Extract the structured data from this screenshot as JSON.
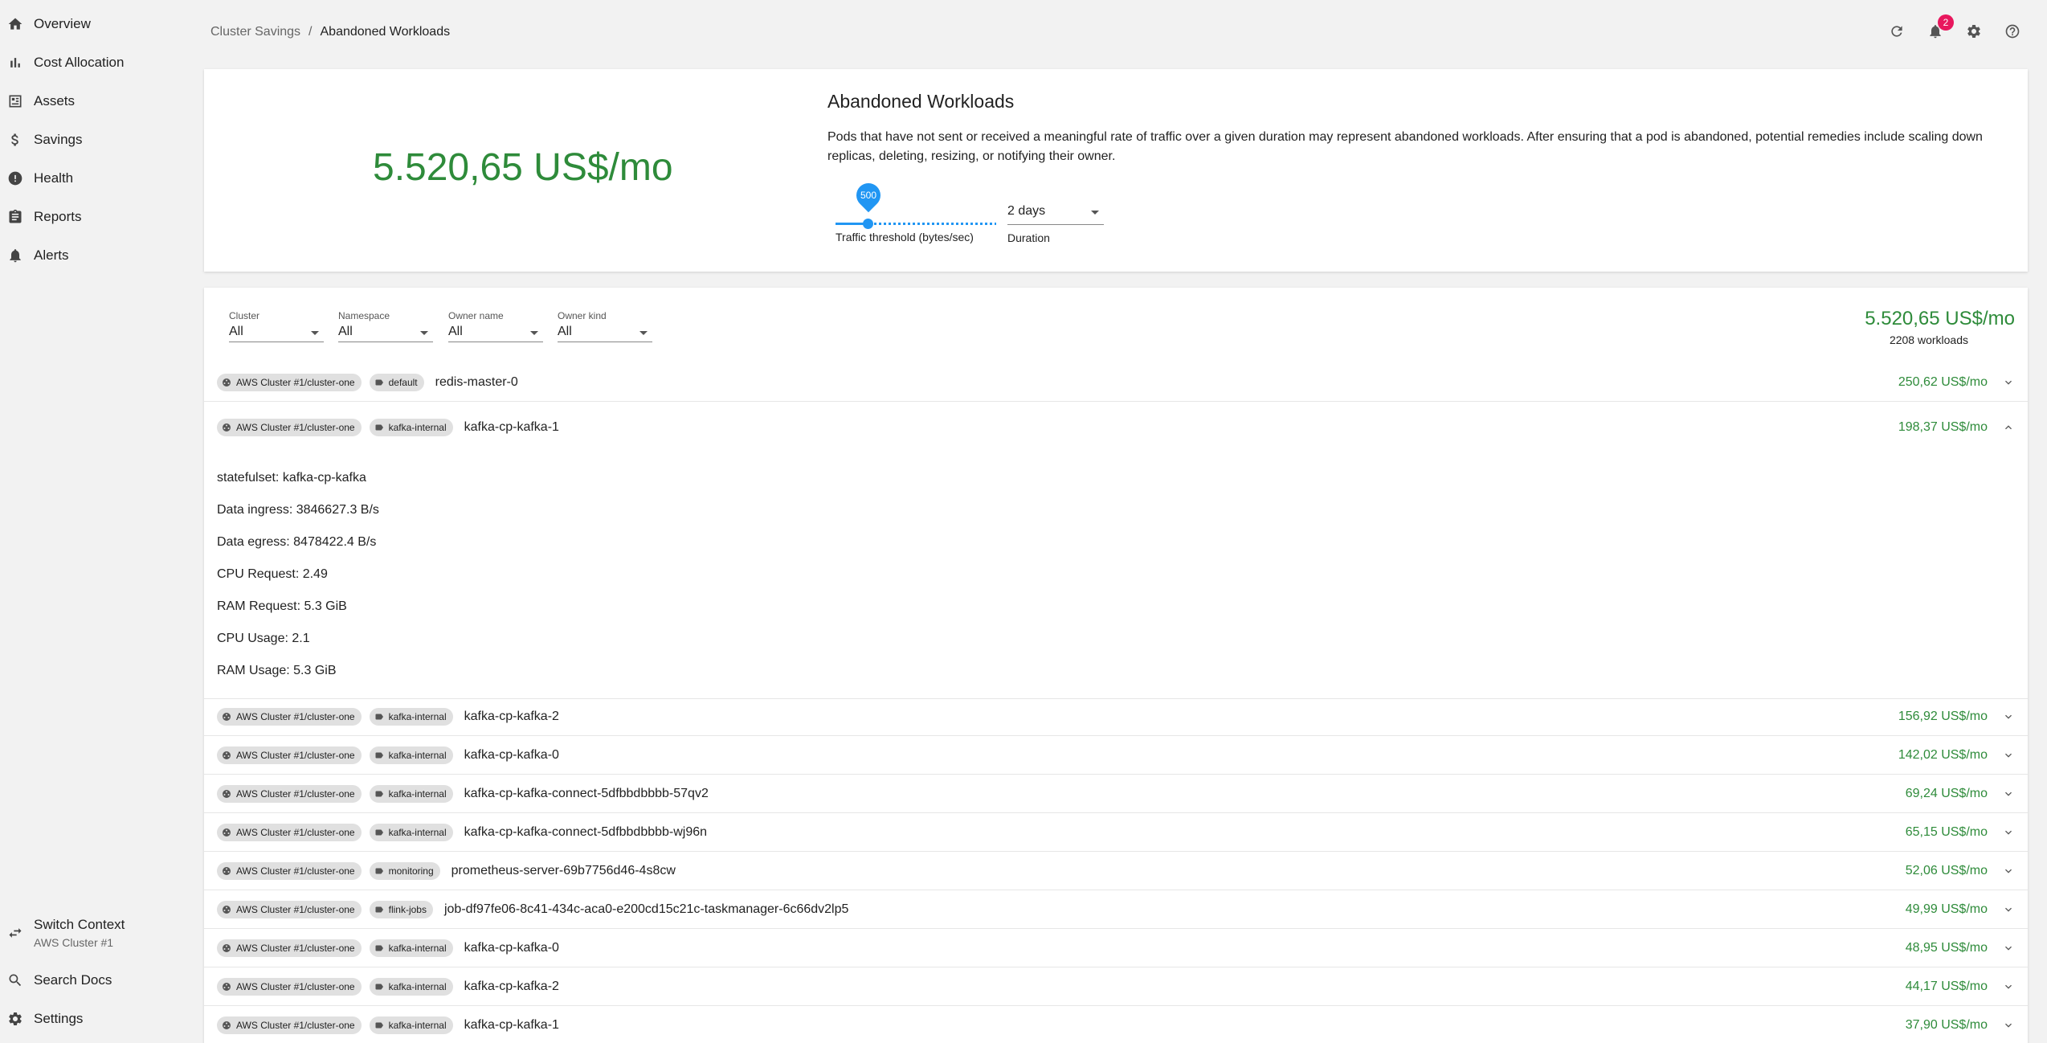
{
  "sidebar": {
    "items": [
      {
        "label": "Overview",
        "icon": "home-icon"
      },
      {
        "label": "Cost Allocation",
        "icon": "bar-chart-icon"
      },
      {
        "label": "Assets",
        "icon": "assets-icon"
      },
      {
        "label": "Savings",
        "icon": "dollar-icon"
      },
      {
        "label": "Health",
        "icon": "alert-circle-icon"
      },
      {
        "label": "Reports",
        "icon": "clipboard-icon"
      },
      {
        "label": "Alerts",
        "icon": "bell-icon"
      }
    ],
    "switch_context": {
      "label": "Switch Context",
      "sub": "AWS Cluster #1"
    },
    "search_docs": "Search Docs",
    "settings": "Settings"
  },
  "header": {
    "breadcrumb_parent": "Cluster Savings",
    "breadcrumb_sep": "/",
    "breadcrumb_current": "Abandoned Workloads",
    "notification_count": "2"
  },
  "summary": {
    "total_cost": "5.520,65 US$/mo",
    "title": "Abandoned Workloads",
    "description": "Pods that have not sent or received a meaningful rate of traffic over a given duration may represent abandoned workloads. After ensuring that a pod is abandoned, potential remedies include scaling down replicas, deleting, resizing, or notifying their owner.",
    "slider_value": "500",
    "slider_label": "Traffic threshold (bytes/sec)",
    "duration_value": "2 days",
    "duration_label": "Duration"
  },
  "filters": [
    {
      "label": "Cluster",
      "value": "All"
    },
    {
      "label": "Namespace",
      "value": "All"
    },
    {
      "label": "Owner name",
      "value": "All"
    },
    {
      "label": "Owner kind",
      "value": "All"
    }
  ],
  "totals": {
    "cost": "5.520,65 US$/mo",
    "count": "2208 workloads"
  },
  "workloads": [
    {
      "cluster": "AWS Cluster #1/cluster-one",
      "namespace": "default",
      "name": "redis-master-0",
      "cost": "250,62 US$/mo",
      "expanded": false
    },
    {
      "cluster": "AWS Cluster #1/cluster-one",
      "namespace": "kafka-internal",
      "name": "kafka-cp-kafka-1",
      "cost": "198,37 US$/mo",
      "expanded": true
    },
    {
      "cluster": "AWS Cluster #1/cluster-one",
      "namespace": "kafka-internal",
      "name": "kafka-cp-kafka-2",
      "cost": "156,92 US$/mo",
      "expanded": false
    },
    {
      "cluster": "AWS Cluster #1/cluster-one",
      "namespace": "kafka-internal",
      "name": "kafka-cp-kafka-0",
      "cost": "142,02 US$/mo",
      "expanded": false
    },
    {
      "cluster": "AWS Cluster #1/cluster-one",
      "namespace": "kafka-internal",
      "name": "kafka-cp-kafka-connect-5dfbbdbbbb-57qv2",
      "cost": "69,24 US$/mo",
      "expanded": false
    },
    {
      "cluster": "AWS Cluster #1/cluster-one",
      "namespace": "kafka-internal",
      "name": "kafka-cp-kafka-connect-5dfbbdbbbb-wj96n",
      "cost": "65,15 US$/mo",
      "expanded": false
    },
    {
      "cluster": "AWS Cluster #1/cluster-one",
      "namespace": "monitoring",
      "name": "prometheus-server-69b7756d46-4s8cw",
      "cost": "52,06 US$/mo",
      "expanded": false
    },
    {
      "cluster": "AWS Cluster #1/cluster-one",
      "namespace": "flink-jobs",
      "name": "job-df97fe06-8c41-434c-aca0-e200cd15c21c-taskmanager-6c66dv2lp5",
      "cost": "49,99 US$/mo",
      "expanded": false
    },
    {
      "cluster": "AWS Cluster #1/cluster-one",
      "namespace": "kafka-internal",
      "name": "kafka-cp-kafka-0",
      "cost": "48,95 US$/mo",
      "expanded": false
    },
    {
      "cluster": "AWS Cluster #1/cluster-one",
      "namespace": "kafka-internal",
      "name": "kafka-cp-kafka-2",
      "cost": "44,17 US$/mo",
      "expanded": false
    },
    {
      "cluster": "AWS Cluster #1/cluster-one",
      "namespace": "kafka-internal",
      "name": "kafka-cp-kafka-1",
      "cost": "37,90 US$/mo",
      "expanded": false
    }
  ],
  "details": [
    "statefulset: kafka-cp-kafka",
    "Data ingress: 3846627.3 B/s",
    "Data egress: 8478422.4 B/s",
    "CPU Request: 2.49",
    "RAM Request: 5.3 GiB",
    "CPU Usage: 2.1",
    "RAM Usage: 5.3 GiB"
  ],
  "colors": {
    "accent": "#2196f3",
    "cost_green": "#2e8b3a",
    "badge": "#e8175d"
  }
}
